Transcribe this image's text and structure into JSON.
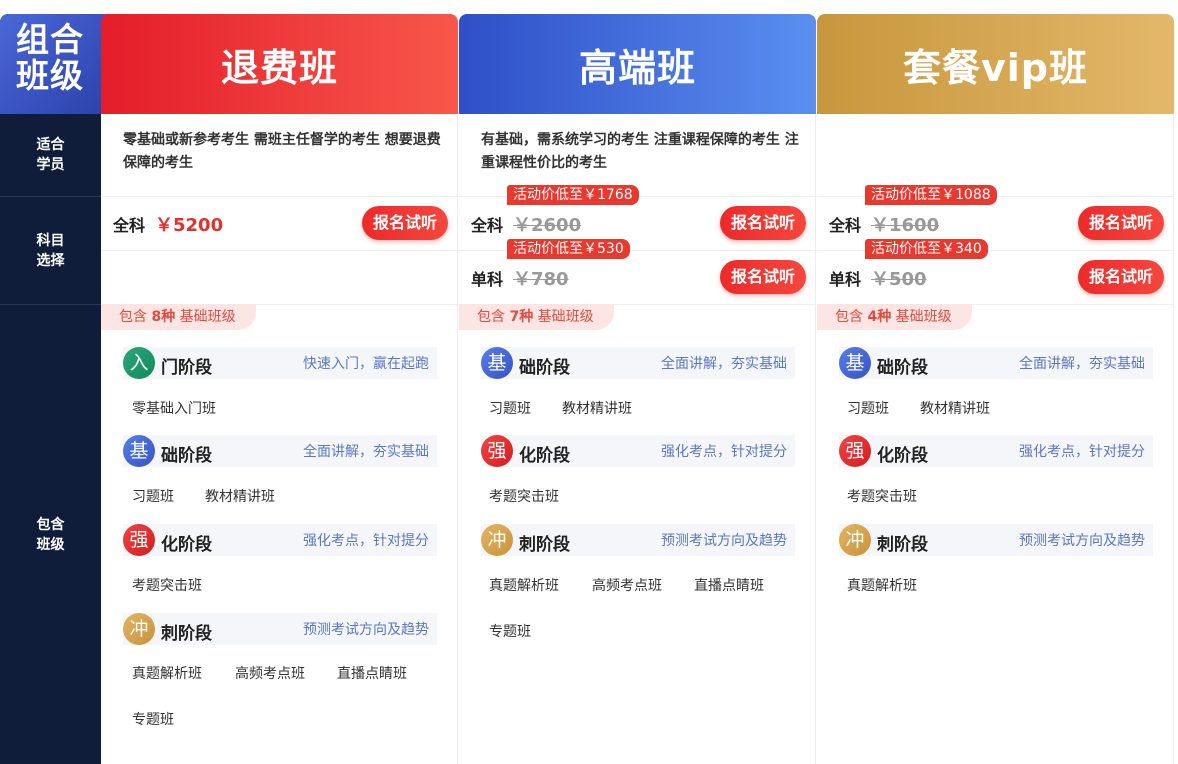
{
  "corner_title": "组合班级",
  "row_labels": {
    "suitable": "适合学员",
    "subject": "科目选择",
    "includes": "包含班级"
  },
  "signup_label": "报名试听",
  "columns": [
    {
      "title": "退费班",
      "suitable": "零基础或新参考考生 需班主任督学的考生 想要退费保障的考生",
      "prices": [
        {
          "name": "全科",
          "price": "￥5200",
          "promo": ""
        }
      ],
      "includes_prefix": "包含",
      "includes_count": "8种",
      "includes_suffix": "基础班级",
      "stages": [
        {
          "icon": "入",
          "name": "门阶段",
          "desc": "快速入门，赢在起跑",
          "classes": [
            "零基础入门班"
          ]
        },
        {
          "icon": "基",
          "name": "础阶段",
          "desc": "全面讲解，夯实基础",
          "classes": [
            "习题班",
            "教材精讲班"
          ]
        },
        {
          "icon": "强",
          "name": "化阶段",
          "desc": "强化考点，针对提分",
          "classes": [
            "考题突击班"
          ]
        },
        {
          "icon": "冲",
          "name": "刺阶段",
          "desc": "预测考试方向及趋势",
          "classes": [
            "真题解析班",
            "高频考点班",
            "直播点睛班",
            "专题班"
          ]
        }
      ]
    },
    {
      "title": "高端班",
      "suitable": "有基础，需系统学习的考生 注重课程保障的考生 注重课程性价比的考生",
      "prices": [
        {
          "name": "全科",
          "price": "￥2600",
          "promo": "活动价低至￥1768"
        },
        {
          "name": "单科",
          "price": "￥780",
          "promo": "活动价低至￥530"
        }
      ],
      "includes_prefix": "包含",
      "includes_count": "7种",
      "includes_suffix": "基础班级",
      "stages": [
        {
          "icon": "基",
          "name": "础阶段",
          "desc": "全面讲解，夯实基础",
          "classes": [
            "习题班",
            "教材精讲班"
          ]
        },
        {
          "icon": "强",
          "name": "化阶段",
          "desc": "强化考点，针对提分",
          "classes": [
            "考题突击班"
          ]
        },
        {
          "icon": "冲",
          "name": "刺阶段",
          "desc": "预测考试方向及趋势",
          "classes": [
            "真题解析班",
            "高频考点班",
            "直播点睛班",
            "专题班"
          ]
        }
      ]
    },
    {
      "title": "套餐vip班",
      "suitable": "",
      "prices": [
        {
          "name": "全科",
          "price": "￥1600",
          "promo": "活动价低至￥1088"
        },
        {
          "name": "单科",
          "price": "￥500",
          "promo": "活动价低至￥340"
        }
      ],
      "includes_prefix": "包含",
      "includes_count": "4种",
      "includes_suffix": "基础班级",
      "stages": [
        {
          "icon": "基",
          "name": "础阶段",
          "desc": "全面讲解，夯实基础",
          "classes": [
            "习题班",
            "教材精讲班"
          ]
        },
        {
          "icon": "强",
          "name": "化阶段",
          "desc": "强化考点，针对提分",
          "classes": [
            "考题突击班"
          ]
        },
        {
          "icon": "冲",
          "name": "刺阶段",
          "desc": "预测考试方向及趋势",
          "classes": [
            "真题解析班"
          ]
        }
      ]
    }
  ]
}
